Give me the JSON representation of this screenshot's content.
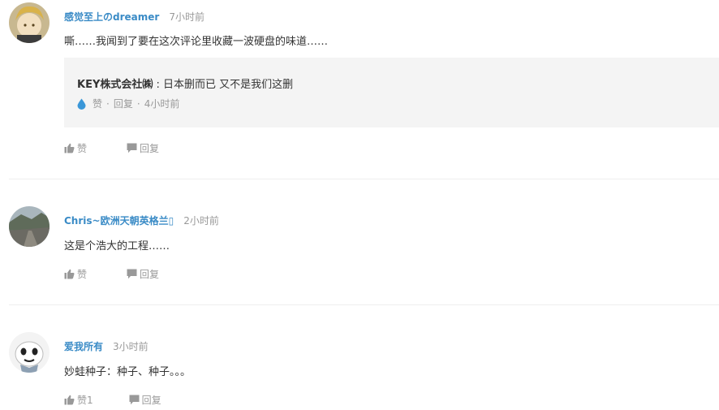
{
  "comments": [
    {
      "username": "感觉至上のdreamer",
      "time": "7小时前",
      "text": "嘶……我闻到了要在这次评论里收藏一波硬盘的味道……",
      "reply": {
        "author": "KEY株式会社㈱",
        "separator": " : ",
        "text": "日本删而已 又不是我们这删",
        "like_label": "赞",
        "reply_label": "回复",
        "dot": "·",
        "time": "4小时前"
      },
      "like_label": "赞",
      "reply_label": "回复"
    },
    {
      "username": "Chris~欧洲天朝英格兰▯",
      "time": "2小时前",
      "text": "这是个浩大的工程……",
      "like_label": "赞",
      "reply_label": "回复"
    },
    {
      "username": "爱我所有",
      "time": "3小时前",
      "text": "妙蛙种子：种子、种子。。。",
      "like_label": "赞1",
      "reply_label": "回复"
    }
  ],
  "colors": {
    "username": "#3a8bc6",
    "muted": "#999999",
    "reply_bg": "#f4f4f4",
    "drop": "#3a97d8"
  },
  "icons": [
    "thumbs-up-icon",
    "speech-bubble-icon",
    "water-drop-icon"
  ]
}
